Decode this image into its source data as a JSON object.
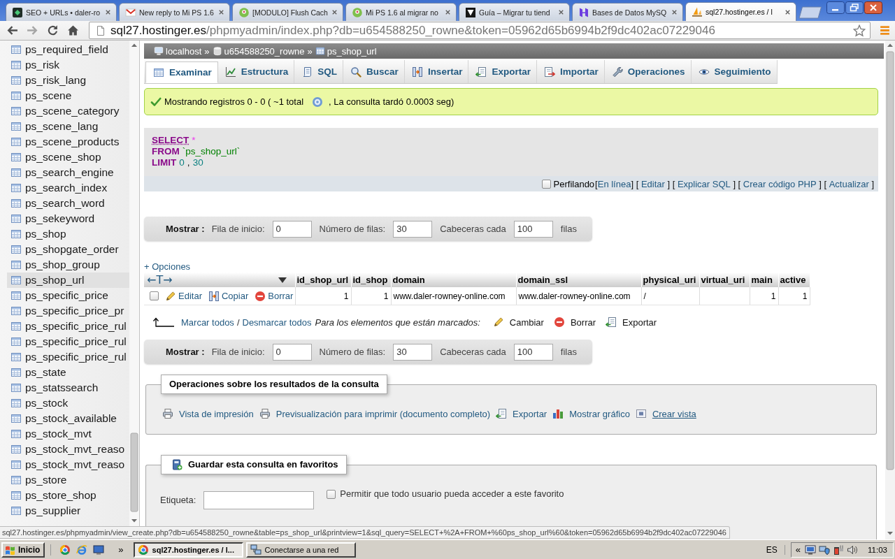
{
  "browser": {
    "tabs": [
      {
        "title": "SEO + URLs • daler-ro",
        "selected": false
      },
      {
        "title": "New reply to Mi PS 1.6",
        "selected": false
      },
      {
        "title": "[MODULO] Flush Cach",
        "selected": false
      },
      {
        "title": "Mi PS 1.6 al migrar no",
        "selected": false
      },
      {
        "title": "Guía – Migrar tu tiend",
        "selected": false
      },
      {
        "title": "Bases de Datos MySQ",
        "selected": false
      },
      {
        "title": "sql27.hostinger.es / l",
        "selected": true
      }
    ],
    "address": {
      "host": "sql27.hostinger.es",
      "path": "/phpmyadmin/index.php?db=u654588250_rowne&token=05962d65b6994b2f9dc402ac07229046"
    }
  },
  "sidebar": {
    "items": [
      {
        "label": "ps_required_field",
        "selected": false
      },
      {
        "label": "ps_risk",
        "selected": false
      },
      {
        "label": "ps_risk_lang",
        "selected": false
      },
      {
        "label": "ps_scene",
        "selected": false
      },
      {
        "label": "ps_scene_category",
        "selected": false
      },
      {
        "label": "ps_scene_lang",
        "selected": false
      },
      {
        "label": "ps_scene_products",
        "selected": false
      },
      {
        "label": "ps_scene_shop",
        "selected": false
      },
      {
        "label": "ps_search_engine",
        "selected": false
      },
      {
        "label": "ps_search_index",
        "selected": false
      },
      {
        "label": "ps_search_word",
        "selected": false
      },
      {
        "label": "ps_sekeyword",
        "selected": false
      },
      {
        "label": "ps_shop",
        "selected": false
      },
      {
        "label": "ps_shopgate_order",
        "selected": false
      },
      {
        "label": "ps_shop_group",
        "selected": false
      },
      {
        "label": "ps_shop_url",
        "selected": true
      },
      {
        "label": "ps_specific_price",
        "selected": false
      },
      {
        "label": "ps_specific_price_pr",
        "selected": false
      },
      {
        "label": "ps_specific_price_rul",
        "selected": false
      },
      {
        "label": "ps_specific_price_rul",
        "selected": false
      },
      {
        "label": "ps_specific_price_rul",
        "selected": false
      },
      {
        "label": "ps_state",
        "selected": false
      },
      {
        "label": "ps_statssearch",
        "selected": false
      },
      {
        "label": "ps_stock",
        "selected": false
      },
      {
        "label": "ps_stock_available",
        "selected": false
      },
      {
        "label": "ps_stock_mvt",
        "selected": false
      },
      {
        "label": "ps_stock_mvt_reaso",
        "selected": false
      },
      {
        "label": "ps_stock_mvt_reaso",
        "selected": false
      },
      {
        "label": "ps_store",
        "selected": false
      },
      {
        "label": "ps_store_shop",
        "selected": false
      },
      {
        "label": "ps_supplier",
        "selected": false
      }
    ]
  },
  "breadcrumb": {
    "items": [
      "localhost",
      "u654588250_rowne",
      "ps_shop_url"
    ],
    "separators": [
      "»",
      "»"
    ]
  },
  "tabs": [
    {
      "label": "Examinar",
      "selected": true
    },
    {
      "label": "Estructura",
      "selected": false
    },
    {
      "label": "SQL",
      "selected": false
    },
    {
      "label": "Buscar",
      "selected": false
    },
    {
      "label": "Insertar",
      "selected": false
    },
    {
      "label": "Exportar",
      "selected": false
    },
    {
      "label": "Importar",
      "selected": false
    },
    {
      "label": "Operaciones",
      "selected": false
    },
    {
      "label": "Seguimiento",
      "selected": false
    }
  ],
  "message": {
    "text": "Mostrando registros 0 - 0 ( ~1 total",
    "text_after": ", La consulta tardó 0.0003 seg)"
  },
  "sql": {
    "lines": [
      [
        {
          "kind": "keyword_link",
          "text": "SELECT"
        },
        {
          "kind": "operator",
          "text": "*"
        }
      ],
      [
        {
          "kind": "keyword",
          "text": "FROM"
        },
        {
          "kind": "identifier",
          "text": "`ps_shop_url`"
        }
      ],
      [
        {
          "kind": "keyword",
          "text": "LIMIT"
        },
        {
          "kind": "number",
          "text": "0"
        },
        {
          "kind": "punctuation",
          "text": ","
        },
        {
          "kind": "number",
          "text": "30"
        }
      ]
    ]
  },
  "sql_bar": {
    "profiling": {
      "label": "Perfilando",
      "checked": false
    },
    "items": [
      {
        "kind": "text",
        "text": "["
      },
      {
        "kind": "link",
        "text": "En línea"
      },
      {
        "kind": "text",
        "text": "] [ "
      },
      {
        "kind": "link",
        "text": "Editar"
      },
      {
        "kind": "text",
        "text": " ] [ "
      },
      {
        "kind": "link",
        "text": "Explicar SQL"
      },
      {
        "kind": "text",
        "text": " ] [ "
      },
      {
        "kind": "link",
        "text": "Crear código PHP"
      },
      {
        "kind": "text",
        "text": " ] [ "
      },
      {
        "kind": "link",
        "text": "Actualizar"
      },
      {
        "kind": "text",
        "text": " ]"
      }
    ]
  },
  "navigation_top": {
    "title": "Mostrar :",
    "fields": [
      {
        "label": "Fila de inicio:",
        "value": "0"
      },
      {
        "label": "Número de filas:",
        "value": "30"
      },
      {
        "label": "Cabeceras cada",
        "value": "100"
      }
    ],
    "suffix": "filas"
  },
  "options_link": "+ Opciones",
  "table": {
    "column_toggle": "←T→",
    "columns": [
      {
        "label": "id_shop_url",
        "kind": "number"
      },
      {
        "label": "id_shop",
        "kind": "number"
      },
      {
        "label": "domain",
        "kind": "text"
      },
      {
        "label": "domain_ssl",
        "kind": "text"
      },
      {
        "label": "physical_uri",
        "kind": "text"
      },
      {
        "label": "virtual_uri",
        "kind": "text"
      },
      {
        "label": "main",
        "kind": "number"
      },
      {
        "label": "active",
        "kind": "number"
      }
    ],
    "rows": [
      {
        "checked": false,
        "actions": [
          "Editar",
          "Copiar",
          "Borrar"
        ],
        "cells": [
          "1",
          "1",
          "www.daler-rowney-online.com",
          "www.daler-rowney-online.com",
          "/",
          null,
          "1",
          "1"
        ]
      }
    ]
  },
  "bulk_actions": {
    "select_all": "Marcar todos",
    "separator": "/",
    "deselect_all": "Desmarcar todos",
    "with_selected": "Para los elementos que están marcados:",
    "buttons": [
      "Cambiar",
      "Borrar",
      "Exportar"
    ]
  },
  "navigation_bottom": {
    "title": "Mostrar :",
    "fields": [
      {
        "label": "Fila de inicio:",
        "value": "0"
      },
      {
        "label": "Número de filas:",
        "value": "30"
      },
      {
        "label": "Cabeceras cada",
        "value": "100"
      }
    ],
    "suffix": "filas"
  },
  "query_results_operations": {
    "title": "Operaciones sobre los resultados de la consulta",
    "links": [
      {
        "label": "Vista de impresión",
        "underlined": false
      },
      {
        "label": "Previsualización para imprimir (documento completo)",
        "underlined": false
      },
      {
        "label": "Exportar",
        "underlined": false
      },
      {
        "label": "Mostrar gráfico",
        "underlined": false
      },
      {
        "label": "Crear vista",
        "underlined": true
      }
    ]
  },
  "bookmark": {
    "title": "Guardar esta consulta en favoritos",
    "label_field": {
      "label": "Etiqueta:"
    },
    "public": {
      "label": "Permitir que todo usuario pueda acceder a este favorito",
      "checked": false
    }
  },
  "status_url": "sql27.hostinger.es/phpmyadmin/view_create.php?db=u654588250_rowne&table=ps_shop_url&printview=1&sql_query=SELECT+%2A+FROM+%60ps_shop_url%60&token=05962d65b6994b2f9dc402ac07229046",
  "taskbar": {
    "start": "Inicio",
    "more": "»",
    "tasks": [
      {
        "label": "sql27.hostinger.es / l...",
        "selected": true
      },
      {
        "label": "Conectarse a una red",
        "selected": false
      }
    ],
    "language": "ES",
    "tray_expand": "«",
    "clock": "11:03"
  }
}
